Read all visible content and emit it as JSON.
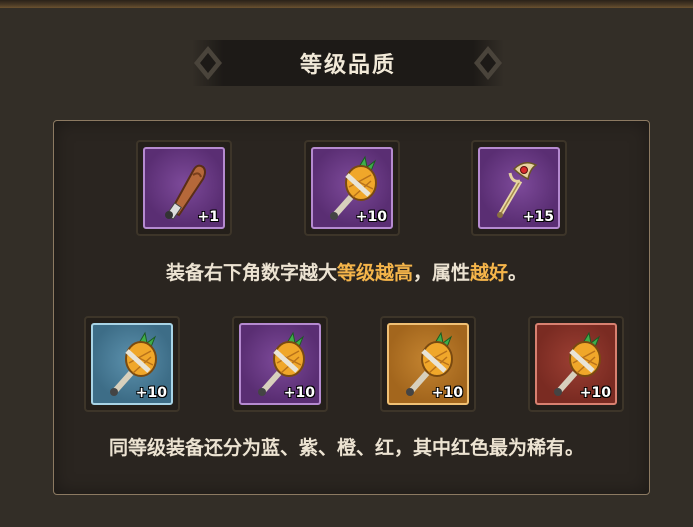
{
  "title": "等级品质",
  "caption1": {
    "part1": "装备右下角数字越大",
    "hl1": "等级越高",
    "part2": "，属性",
    "hl2": "越好",
    "part3": "。"
  },
  "caption2": "同等级装备还分为蓝、紫、橙、红，其中红色最为稀有。",
  "row1": [
    {
      "icon": "club-icon",
      "rarity": "purple",
      "level": "+1"
    },
    {
      "icon": "pineapple-mace-icon",
      "rarity": "purple",
      "level": "+10"
    },
    {
      "icon": "scepter-icon",
      "rarity": "purple",
      "level": "+15"
    }
  ],
  "row2": [
    {
      "icon": "pineapple-mace-icon",
      "rarity": "blue",
      "level": "+10"
    },
    {
      "icon": "pineapple-mace-icon",
      "rarity": "purple",
      "level": "+10"
    },
    {
      "icon": "pineapple-mace-icon",
      "rarity": "orange",
      "level": "+10"
    },
    {
      "icon": "pineapple-mace-icon",
      "rarity": "red",
      "level": "+10"
    }
  ],
  "colors": {
    "highlight": "#f5b54a",
    "text": "#ece3d2",
    "blue": "#3d6d87",
    "purple": "#5a2e73",
    "orange": "#a3661d",
    "red": "#7a2b22"
  }
}
